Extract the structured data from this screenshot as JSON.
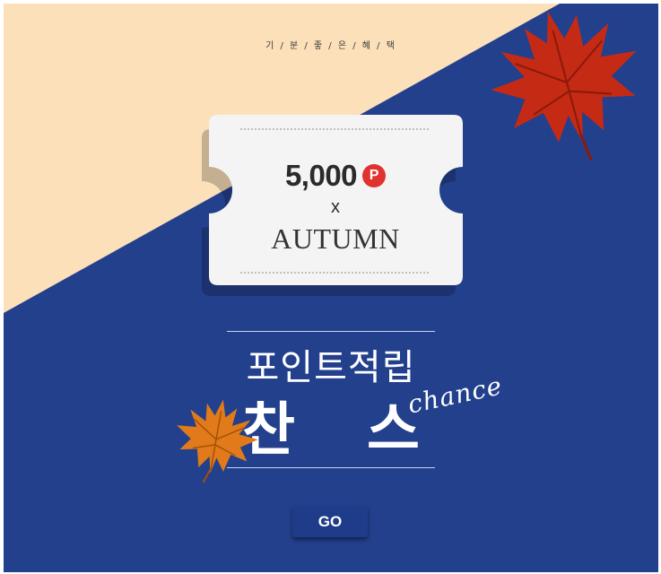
{
  "tagline": "기 / 분 / 좋 / 은 / 혜 / 택",
  "ticket": {
    "amount": "5,000",
    "point_badge": "P",
    "times_symbol": "x",
    "season": "AUTUMN"
  },
  "headline": {
    "main": "포인트적립",
    "big": "찬스",
    "script": "chance"
  },
  "button": {
    "go_label": "GO"
  },
  "colors": {
    "background_blue": "#23408d",
    "cream": "#fce0ba",
    "badge_red": "#e0322f",
    "button_blue": "#1e3c8a"
  },
  "icons": [
    "red-maple-leaf-icon",
    "orange-maple-leaf-icon"
  ]
}
